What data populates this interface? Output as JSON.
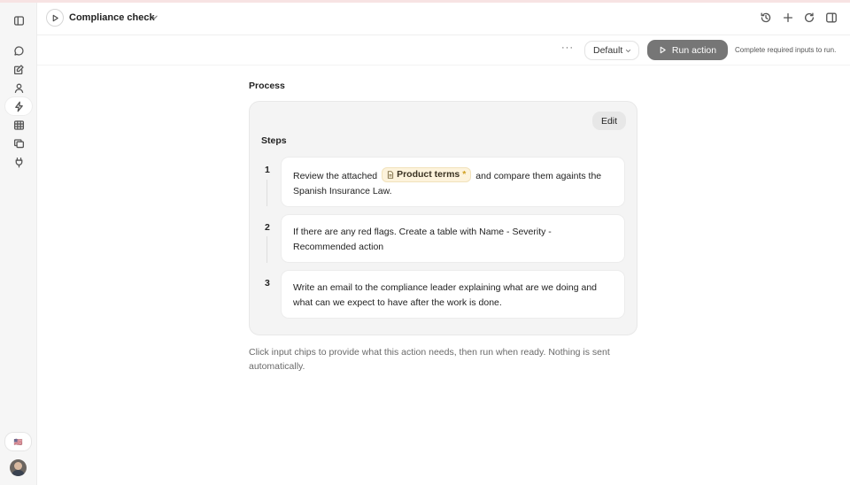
{
  "header": {
    "title": "Compliance check"
  },
  "toolbar": {
    "more_label": "···",
    "preset_value": "Default",
    "run_label": "Run action",
    "run_hint": "Complete required inputs to run."
  },
  "sidebar": {
    "items": [
      {
        "icon": "panel-toggle-icon"
      },
      {
        "icon": "chat-icon"
      },
      {
        "icon": "edit-note-icon"
      },
      {
        "icon": "person-icon"
      },
      {
        "icon": "bolt-icon",
        "active": true
      },
      {
        "icon": "table-icon"
      },
      {
        "icon": "copies-icon"
      },
      {
        "icon": "plug-icon"
      }
    ],
    "language_flag": "🇺🇸"
  },
  "main": {
    "section_title": "Process",
    "edit_label": "Edit",
    "steps_title": "Steps",
    "steps": [
      {
        "number": "1",
        "text_before": "Review the attached",
        "chip_label": "Product terms",
        "chip_required": "*",
        "text_after": "and compare them againts the Spanish Insurance Law."
      },
      {
        "number": "2",
        "text": "If there are any red flags. Create a table with Name - Severity - Recommended action"
      },
      {
        "number": "3",
        "text": "Write an email to the compliance leader explaining what are we doing and what can we expect to have after the work is done."
      }
    ],
    "footer_note": "Click input chips to provide what this action needs, then run when ready. Nothing is sent automatically."
  },
  "colors": {
    "run_button_bg": "#767676",
    "chip_bg": "#fdf3dc",
    "panel_bg": "#f4f4f4",
    "sidebar_bg": "#f6f6f6"
  }
}
